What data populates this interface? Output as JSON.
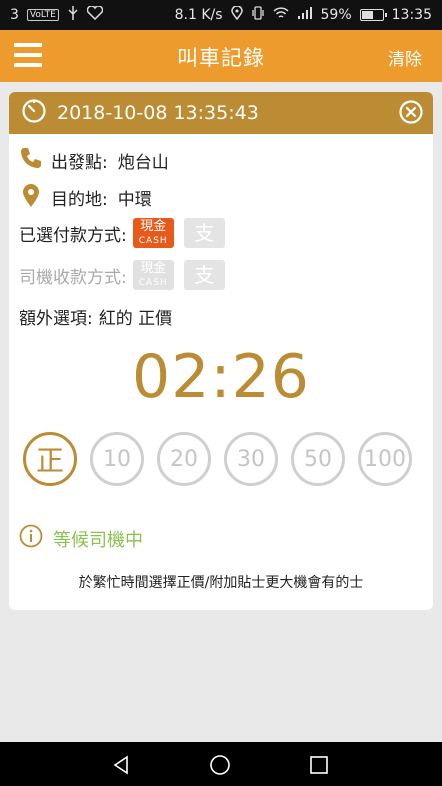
{
  "status_bar": {
    "left_number": "3",
    "volte": "VoLTE",
    "speed": "8.1 K/s",
    "battery": "59%",
    "time": "13:35"
  },
  "app_bar": {
    "title": "叫車記錄",
    "clear_label": "清除"
  },
  "record": {
    "datetime": "2018-10-08 13:35:43",
    "pickup_label": "出發點:",
    "pickup_value": "炮台山",
    "destination_label": "目的地:",
    "destination_value": "中環",
    "selected_payment_label": "已選付款方式:",
    "driver_payment_label": "司機收款方式:",
    "cash_badge_top": "現金",
    "cash_badge_bottom": "CASH",
    "alipay_glyph": "支",
    "extra_options_label": "額外選項:",
    "extra_options_value": "紅的 正價",
    "timer": "02:26",
    "tips": [
      "正",
      "10",
      "20",
      "30",
      "50",
      "100"
    ],
    "active_tip_index": 0,
    "waiting_status": "等候司機中",
    "hint": "於繁忙時間選擇正價/附加貼士更大機會有的士"
  },
  "colors": {
    "app_bar": "#ec9b2c",
    "card_header": "#bb8c33",
    "cash": "#e85a1c",
    "waiting": "#8cc152"
  }
}
